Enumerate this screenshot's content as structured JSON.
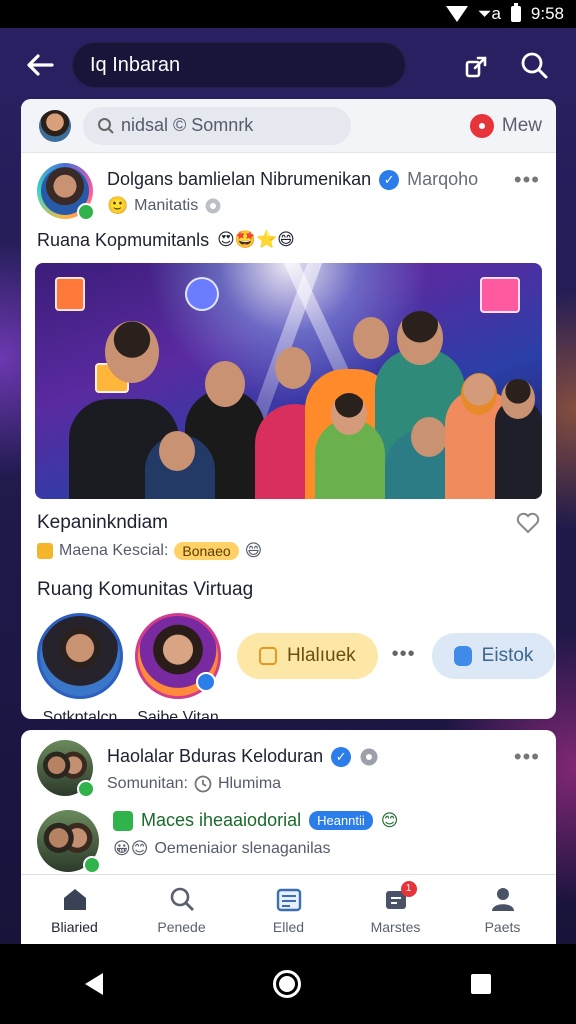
{
  "status_bar": {
    "network": "⏷a",
    "time": "9:58"
  },
  "header": {
    "search_text": "Iq  Inbaran"
  },
  "compose": {
    "placeholder": "nidsal  © Somnrk",
    "new_label": "Mew"
  },
  "post1": {
    "title": "Dolgans bamlielan Nibrumenikan",
    "title_suffix": "Marqoho",
    "subtitle": "Manitatis",
    "subtitle_emoji": "🙂",
    "caption": "Ruana Kopmumitanls",
    "caption_emojis": "😍🤩⭐😄",
    "image_alt": "Group of young people holding phones with glowing social icons",
    "footer_name": "Kepaninkndiam",
    "tag_text": "Maena Kescial:",
    "tag_pill": "Bonaeo",
    "community_title": "Ruang Komunitas Virtuag",
    "members": [
      {
        "label": "Sotkptalcn"
      },
      {
        "label": "Saibe Vitan"
      }
    ],
    "chip_yellow": "Hlalıuek",
    "chip_blue": "Eistok"
  },
  "post2": {
    "title": "Haolalar Bduras Keloduran",
    "subtitle": "Somunitan:",
    "subtitle_suffix": "Hlumima",
    "thread_title": "Maces iheaaiodorial",
    "thread_pill": "Heanntii",
    "thread_emoji": "😊",
    "thread_sub": "Oemeniaior slenaganilas",
    "thread_sub_emojis": "😀😊"
  },
  "bottom_nav": [
    {
      "label": "Bliaried",
      "icon": "home-icon"
    },
    {
      "label": "Penede",
      "icon": "search-icon"
    },
    {
      "label": "Elled",
      "icon": "calendar-icon"
    },
    {
      "label": "Marstes",
      "icon": "messages-icon",
      "badge": "1"
    },
    {
      "label": "Paets",
      "icon": "profile-icon"
    }
  ],
  "colors": {
    "accent": "#2b7de9",
    "brand_bg": "#1d1847",
    "badge": "#e6343a",
    "chip_yellow": "#fde7a7",
    "chip_blue": "#dde8f6"
  }
}
